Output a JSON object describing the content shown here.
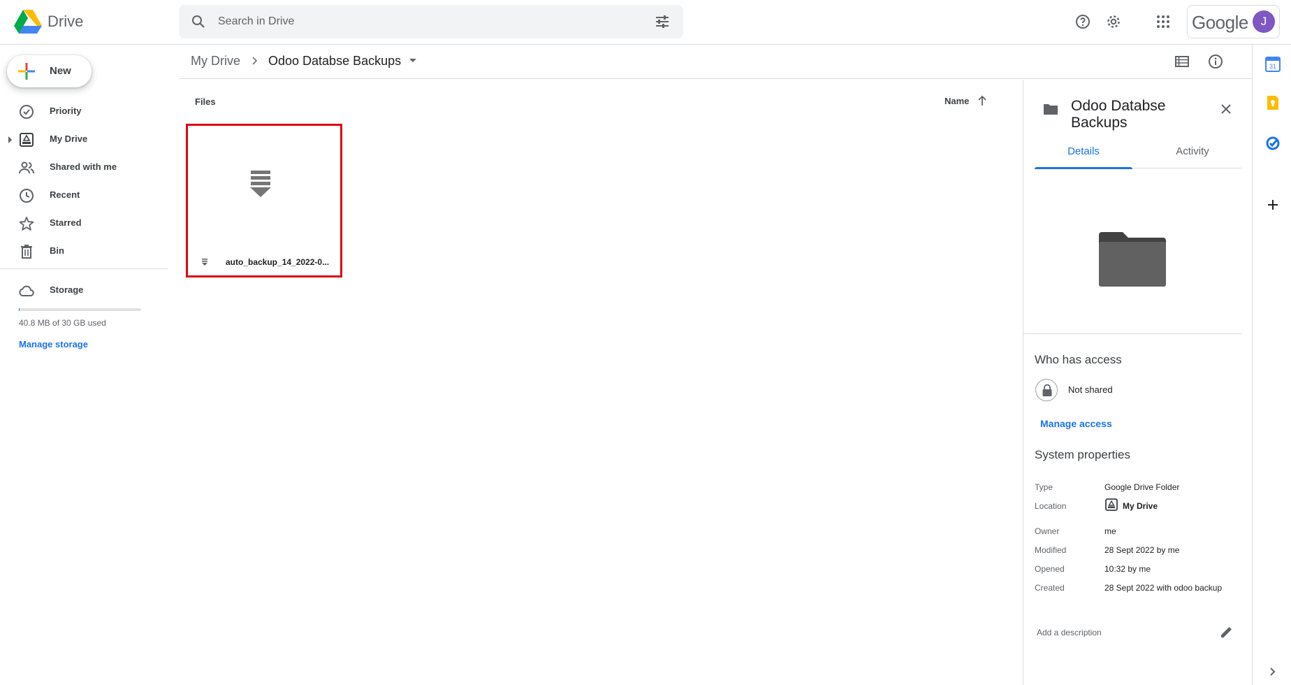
{
  "header": {
    "app_name": "Drive",
    "search_placeholder": "Search in Drive",
    "google_label": "Google",
    "avatar_initial": "J",
    "avatar_color": "#7e57c2"
  },
  "sidebar": {
    "new_label": "New",
    "items": [
      {
        "label": "Priority",
        "icon": "priority-check-icon"
      },
      {
        "label": "My Drive",
        "icon": "my-drive-icon"
      },
      {
        "label": "Shared with me",
        "icon": "shared-people-icon"
      },
      {
        "label": "Recent",
        "icon": "clock-icon"
      },
      {
        "label": "Starred",
        "icon": "star-icon"
      },
      {
        "label": "Bin",
        "icon": "trash-icon"
      }
    ],
    "storage_label": "Storage",
    "storage_used_fraction": 0.0014,
    "storage_text": "40.8 MB of 30 GB used",
    "manage_storage": "Manage storage"
  },
  "breadcrumb": {
    "root": "My Drive",
    "current": "Odoo Databse Backups"
  },
  "main": {
    "files_label": "Files",
    "sort_label": "Name",
    "files": [
      {
        "name": "auto_backup_14_2022-0..."
      }
    ]
  },
  "details": {
    "title": "Odoo Databse Backups",
    "tabs": [
      "Details",
      "Activity"
    ],
    "who_has_access": "Who has access",
    "not_shared": "Not shared",
    "manage_access": "Manage access",
    "system_properties": "System properties",
    "properties": [
      {
        "key": "Type",
        "value": "Google Drive Folder"
      },
      {
        "key": "Location",
        "value": "My Drive"
      },
      {
        "key": "Owner",
        "value": "me"
      },
      {
        "key": "Modified",
        "value": "28 Sept 2022 by me"
      },
      {
        "key": "Opened",
        "value": "10:32 by me"
      },
      {
        "key": "Created",
        "value": "28 Sept 2022 with odoo backup"
      }
    ],
    "add_description": "Add a description"
  },
  "colors": {
    "accent": "#1a73e8",
    "selection_border": "#e0000e"
  }
}
